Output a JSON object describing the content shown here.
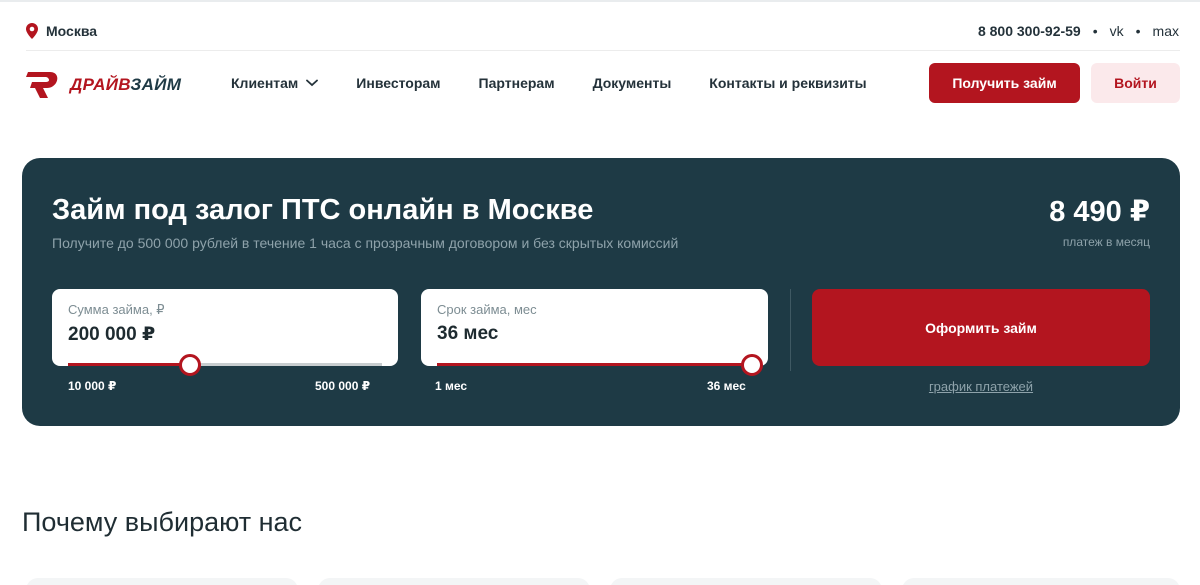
{
  "topbar": {
    "city": "Москва",
    "phone": "8 800 300-92-59",
    "dot": "•",
    "social": [
      "vk",
      "max"
    ]
  },
  "header": {
    "logo_part1": "ДРАЙВ",
    "logo_part2": "ЗАЙМ",
    "nav": [
      "Клиентам",
      "Инвесторам",
      "Партнерам",
      "Документы",
      "Контакты и реквизиты"
    ],
    "get_loan": "Получить займ",
    "login": "Войти"
  },
  "calculator": {
    "title": "Займ под залог ПТС онлайн в Москве",
    "subtitle": "Получите до 500 000 рублей в течение 1 часа с прозрачным договором и без скрытых комиссий",
    "payment": "8 490 ₽",
    "payment_label": "платеж в месяц",
    "amount": {
      "label": "Сумма займа, ₽",
      "value": "200 000 ₽",
      "min": "10 000 ₽",
      "max": "500 000 ₽",
      "slider_fraction": 0.39
    },
    "term": {
      "label": "Срок займа, мес",
      "value": "36 мес",
      "min": "1 мес",
      "max": "36 мес",
      "slider_fraction": 1.0
    },
    "apply": "Оформить займ",
    "schedule": "график платежей"
  },
  "why": {
    "title": "Почему выбирают нас"
  },
  "colors": {
    "brand_red": "#b3151f",
    "card_bg": "#1e3a45"
  }
}
